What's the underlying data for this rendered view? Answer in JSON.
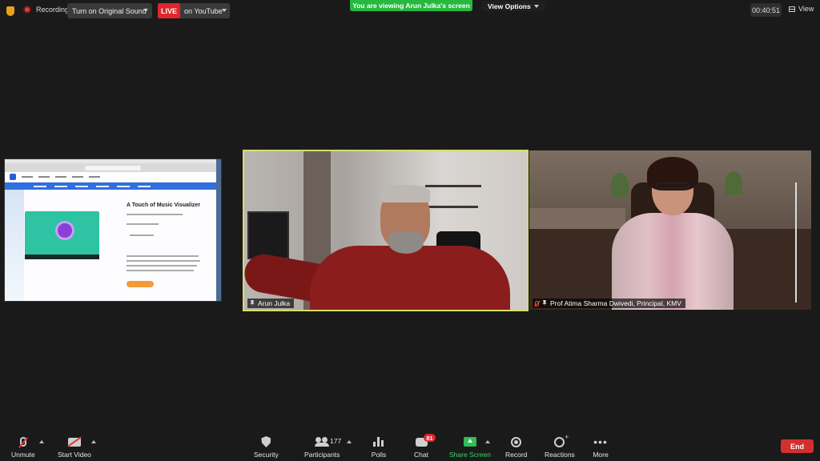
{
  "topbar": {
    "recording_label": "Recording",
    "sound_button_label": "Turn on Original Sound",
    "live_badge": "LIVE",
    "live_target": "on YouTube",
    "viewing_banner": "You are viewing Arun Julka's screen",
    "view_options_label": "View Options",
    "timer": "00:40:51",
    "view_label": "View"
  },
  "shared_screen": {
    "page_title": "A Touch of Music Visualizer"
  },
  "participants": {
    "active": {
      "name": "Arun Julka"
    },
    "second": {
      "name": "Prof Atima Sharma Dwivedi, Principal, KMV"
    }
  },
  "toolbar": {
    "unmute": "Unmute",
    "start_video": "Start Video",
    "security": "Security",
    "participants": "Participants",
    "participant_count": "177",
    "polls": "Polls",
    "chat": "Chat",
    "chat_badge": "81",
    "share_screen": "Share Screen",
    "record": "Record",
    "reactions": "Reactions",
    "more": "More",
    "end": "End"
  },
  "colors": {
    "live_red": "#e0262d",
    "banner_green": "#27b840",
    "share_green": "#2fbd56",
    "end_red": "#d32f2f",
    "active_border": "#d6de6a"
  }
}
